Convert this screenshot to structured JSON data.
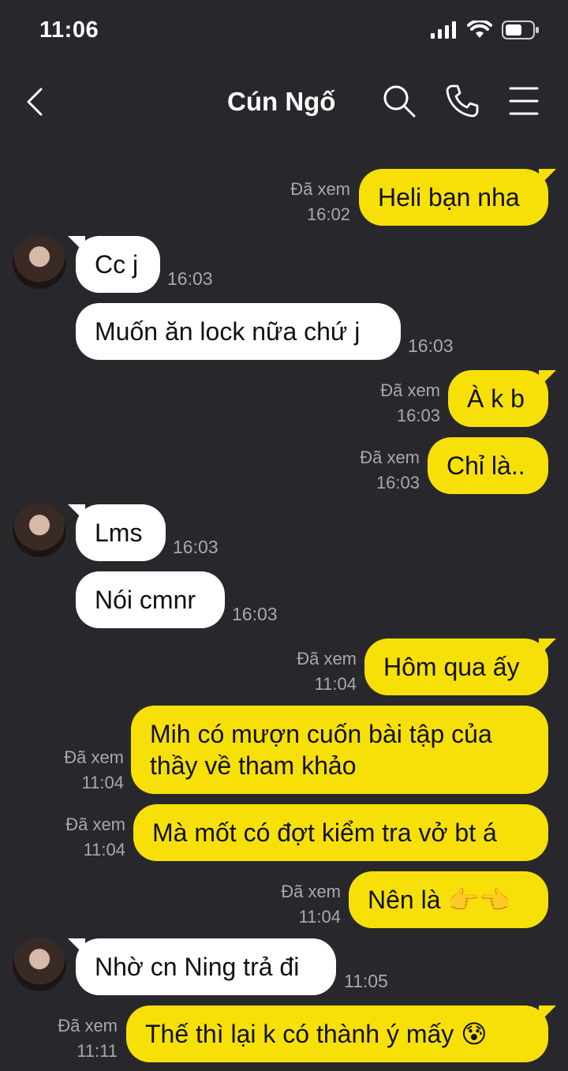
{
  "status_bar": {
    "time": "11:06"
  },
  "header": {
    "title": "Cún Ngố",
    "back_icon": "chevron-left-icon",
    "search_icon": "search-icon",
    "call_icon": "phone-icon",
    "menu_icon": "menu-icon"
  },
  "colors": {
    "background": "#28282c",
    "outgoing_bubble": "#f7e008",
    "incoming_bubble": "#ffffff",
    "meta_text": "#a9a9ad"
  },
  "messages": [
    {
      "direction": "out",
      "text": "Heli bạn nha",
      "seen": "Đã xem",
      "time": "16:02"
    },
    {
      "direction": "in",
      "text": "Cc j",
      "time": "16:03"
    },
    {
      "direction": "in",
      "text": "Muốn ăn lock nữa chứ j",
      "time": "16:03"
    },
    {
      "direction": "out",
      "text": "À k b",
      "seen": "Đã xem",
      "time": "16:03"
    },
    {
      "direction": "out",
      "text": "Chỉ là..",
      "seen": "Đã xem",
      "time": "16:03"
    },
    {
      "direction": "in",
      "text": "Lms",
      "time": "16:03"
    },
    {
      "direction": "in",
      "text": "Nói cmnr",
      "time": "16:03"
    },
    {
      "direction": "out",
      "text": "Hôm qua ấy",
      "seen": "Đã xem",
      "time": "11:04"
    },
    {
      "direction": "out",
      "text_lines": [
        "Mih có mượn cuốn bài tập của",
        "thầy về tham khảo"
      ],
      "seen": "Đã xem",
      "time": "11:04"
    },
    {
      "direction": "out",
      "text": "Mà mốt có đợt kiểm tra vở bt á",
      "seen": "Đã xem",
      "time": "11:04"
    },
    {
      "direction": "out",
      "text": "Nên là",
      "emoji": "👉👈",
      "seen": "Đã xem",
      "time": "11:04"
    },
    {
      "direction": "in",
      "text": "Nhờ cn Ning trả đi",
      "time": "11:05"
    },
    {
      "direction": "out",
      "text": "Thế thì lại k có thành ý mấy",
      "emoji": "😰",
      "seen": "Đã xem",
      "time": "11:11"
    }
  ]
}
